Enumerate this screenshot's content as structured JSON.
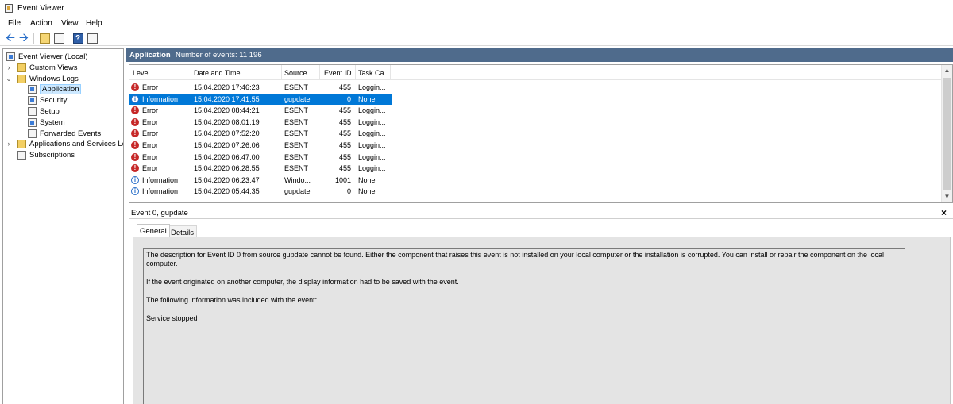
{
  "window": {
    "title": "Event Viewer"
  },
  "menu": [
    "File",
    "Action",
    "View",
    "Help"
  ],
  "toolbar": {
    "icons": [
      "back-arrow-icon",
      "forward-arrow-icon",
      "folder-up-icon",
      "show-hide-tree-icon",
      "help-icon",
      "properties-icon"
    ]
  },
  "tree": {
    "root": "Event Viewer (Local)",
    "custom_views": "Custom Views",
    "windows_logs": "Windows Logs",
    "application": "Application",
    "security": "Security",
    "setup": "Setup",
    "system": "System",
    "forwarded_events": "Forwarded Events",
    "apps_services": "Applications and Services Lo",
    "subscriptions": "Subscriptions"
  },
  "events_header": {
    "title": "Application",
    "count": "Number of events: 11 196"
  },
  "grid": {
    "columns": {
      "level": "Level",
      "datetime": "Date and Time",
      "source": "Source",
      "event_id": "Event ID",
      "task": "Task Ca..."
    },
    "rows": [
      {
        "level": "Error",
        "datetime": "15.04.2020 17:46:23",
        "source": "ESENT",
        "event_id": "455",
        "task": "Loggin..."
      },
      {
        "level": "Information",
        "datetime": "15.04.2020 17:41:55",
        "source": "gupdate",
        "event_id": "0",
        "task": "None"
      },
      {
        "level": "Error",
        "datetime": "15.04.2020 08:44:21",
        "source": "ESENT",
        "event_id": "455",
        "task": "Loggin..."
      },
      {
        "level": "Error",
        "datetime": "15.04.2020 08:01:19",
        "source": "ESENT",
        "event_id": "455",
        "task": "Loggin..."
      },
      {
        "level": "Error",
        "datetime": "15.04.2020 07:52:20",
        "source": "ESENT",
        "event_id": "455",
        "task": "Loggin..."
      },
      {
        "level": "Error",
        "datetime": "15.04.2020 07:26:06",
        "source": "ESENT",
        "event_id": "455",
        "task": "Loggin..."
      },
      {
        "level": "Error",
        "datetime": "15.04.2020 06:47:00",
        "source": "ESENT",
        "event_id": "455",
        "task": "Loggin..."
      },
      {
        "level": "Error",
        "datetime": "15.04.2020 06:28:55",
        "source": "ESENT",
        "event_id": "455",
        "task": "Loggin..."
      },
      {
        "level": "Information",
        "datetime": "15.04.2020 06:23:47",
        "source": "Windo...",
        "event_id": "1001",
        "task": "None"
      },
      {
        "level": "Information",
        "datetime": "15.04.2020 05:44:35",
        "source": "gupdate",
        "event_id": "0",
        "task": "None"
      }
    ]
  },
  "detail": {
    "title": "Event 0, gupdate",
    "tabs": {
      "general": "General",
      "details": "Details"
    },
    "description": [
      "The description for Event ID 0 from source gupdate cannot be found. Either the component that raises this event is not installed on your local computer or the installation is corrupted. You can install or repair the component on the local computer.",
      "If the event originated on another computer, the display information had to be saved with the event.",
      "The following information was included with the event:",
      "Service stopped"
    ]
  }
}
